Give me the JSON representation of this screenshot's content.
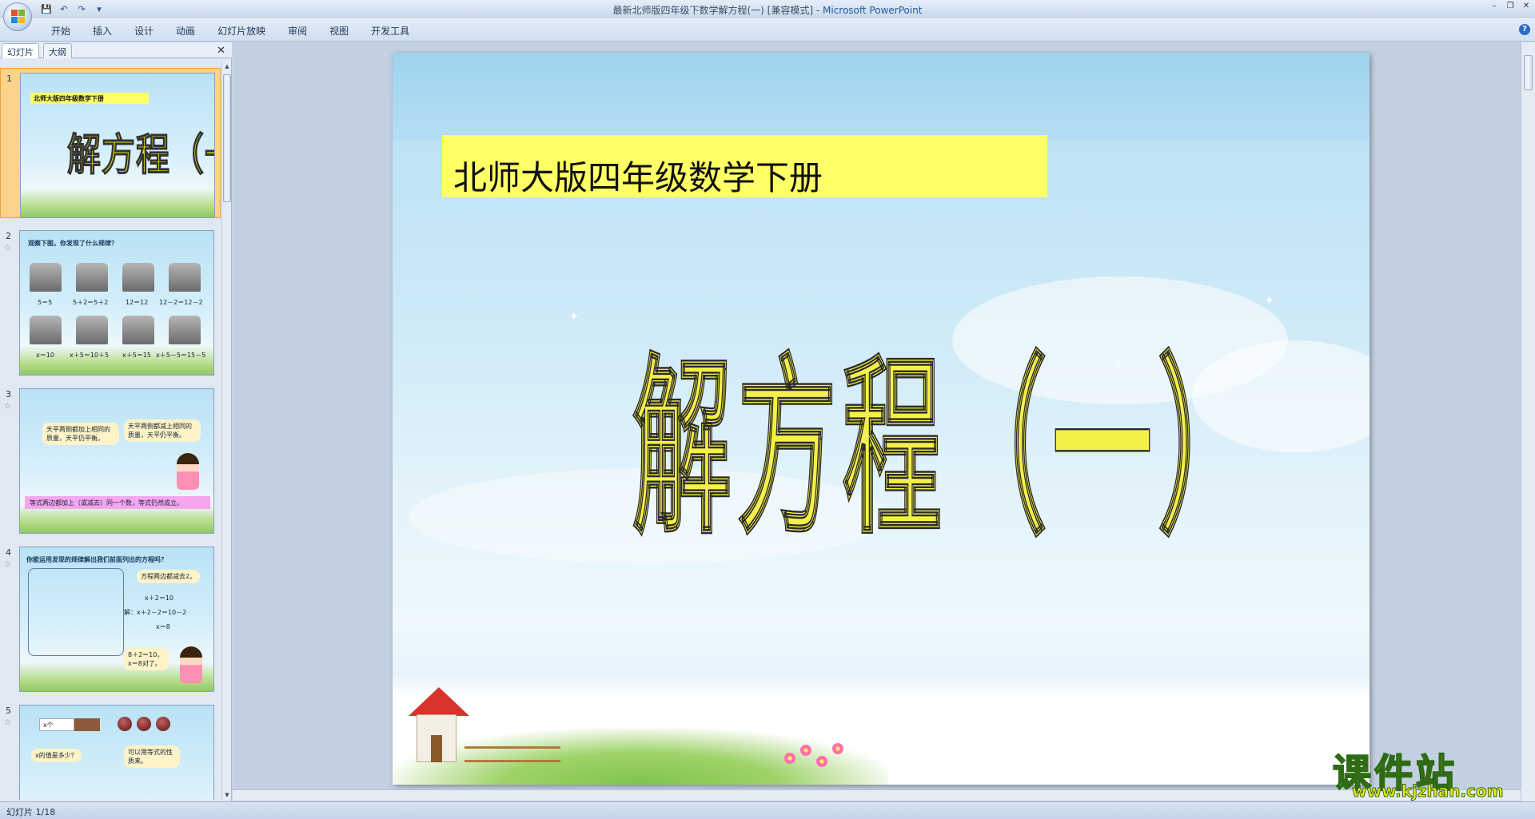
{
  "titlebar": {
    "doc_title": "最新北师版四年级下数学解方程(一) [兼容模式] - ",
    "app_name": "Microsoft PowerPoint",
    "qat_save": "💾",
    "qat_undo": "↶",
    "qat_redo": "↷",
    "qat_more": "▾",
    "min": "–",
    "max": "❐",
    "close": "✕"
  },
  "ribbon": {
    "tabs": [
      "开始",
      "插入",
      "设计",
      "动画",
      "幻灯片放映",
      "审阅",
      "视图",
      "开发工具"
    ],
    "help": "?"
  },
  "left_pane": {
    "tab_slides": "幻灯片",
    "tab_outline": "大纲",
    "close": "✕",
    "thumbnails": [
      {
        "num": "1",
        "header": "北师大版四年级数学下册",
        "title": "解方程（一）"
      },
      {
        "num": "2",
        "header": "观察下图，你发现了什么规律？",
        "labels": [
          "5＝5",
          "5＋2＝5＋2",
          "12＝12",
          "12－2＝12－2",
          "x＝10",
          "x＋5＝10＋5",
          "x＋5＝15",
          "x＋5－5＝15－5"
        ]
      },
      {
        "num": "3",
        "bubble1": "天平两侧都加上相同的质量，天平仍平衡。",
        "bubble2": "天平两侧都减上相同的质量，天平仍平衡。",
        "bar": "等式两边都加上（或减去）同一个数，等式仍然成立。"
      },
      {
        "num": "4",
        "header": "你能运用发现的规律解出我们前面列出的方程吗？",
        "bubble": "方程两边都减去2。",
        "eq1": "x＋2＝10",
        "eq2": "解：x＋2－2＝10－2",
        "eq3": "x＝8",
        "check1": "8＋2＝10，",
        "check2": "x＝8对了。"
      },
      {
        "num": "5",
        "q1": "x的值是多少？",
        "q2": "可以用等式的性质来。",
        "lbl": "x个"
      }
    ]
  },
  "slide": {
    "subtitle": "北师大版四年级数学下册",
    "title": "解方程（一）"
  },
  "watermark": {
    "cn": "课件站",
    "url": "www.kjzhan.com"
  },
  "status": {
    "slide_info": "幻灯片 1/18"
  }
}
